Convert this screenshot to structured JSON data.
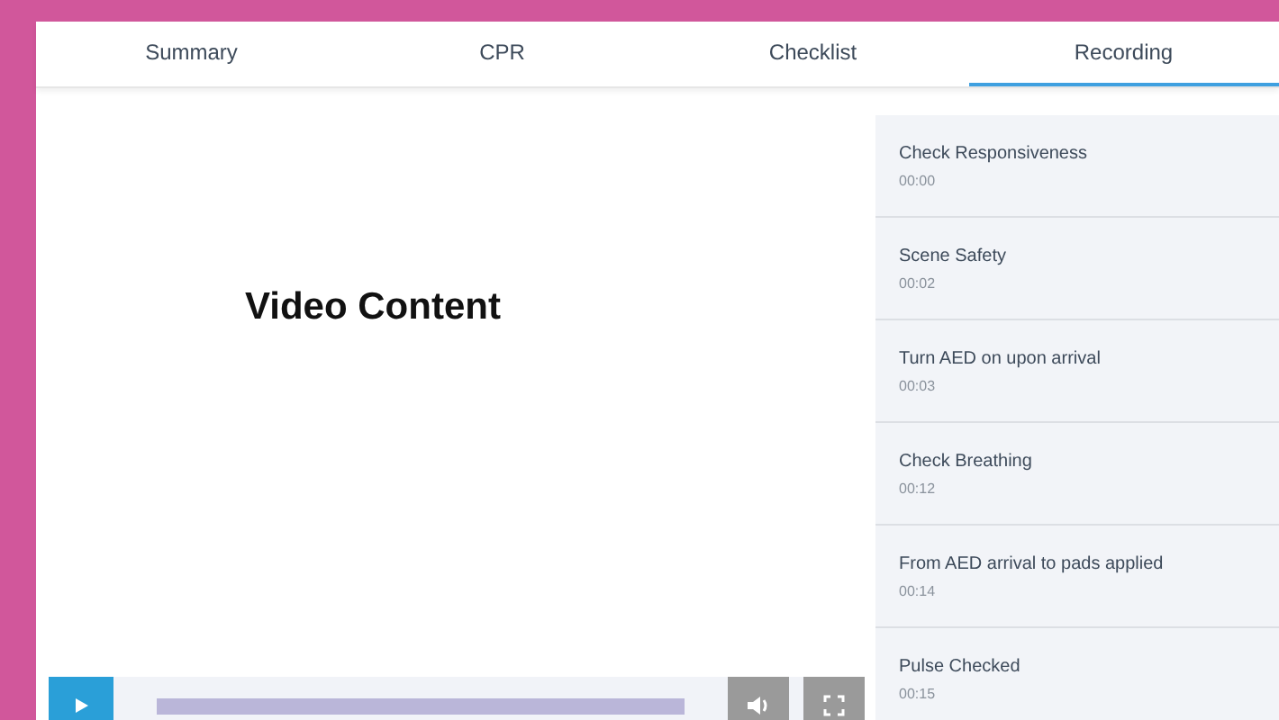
{
  "tabs": [
    {
      "label": "Summary",
      "selected": false
    },
    {
      "label": "CPR",
      "selected": false
    },
    {
      "label": "Checklist",
      "selected": false
    },
    {
      "label": "Recording",
      "selected": true
    }
  ],
  "video": {
    "title": "Video Content",
    "progress": {
      "level": 1
    }
  },
  "events": [
    {
      "name": "Check Responsiveness",
      "time": "00:00"
    },
    {
      "name": "Scene Safety",
      "time": "00:02"
    },
    {
      "name": "Turn AED on upon arrival",
      "time": "00:03"
    },
    {
      "name": "Check Breathing",
      "time": "00:12"
    },
    {
      "name": "From AED arrival to pads applied",
      "time": "00:14"
    },
    {
      "name": "Pulse Checked",
      "time": "00:15"
    }
  ]
}
